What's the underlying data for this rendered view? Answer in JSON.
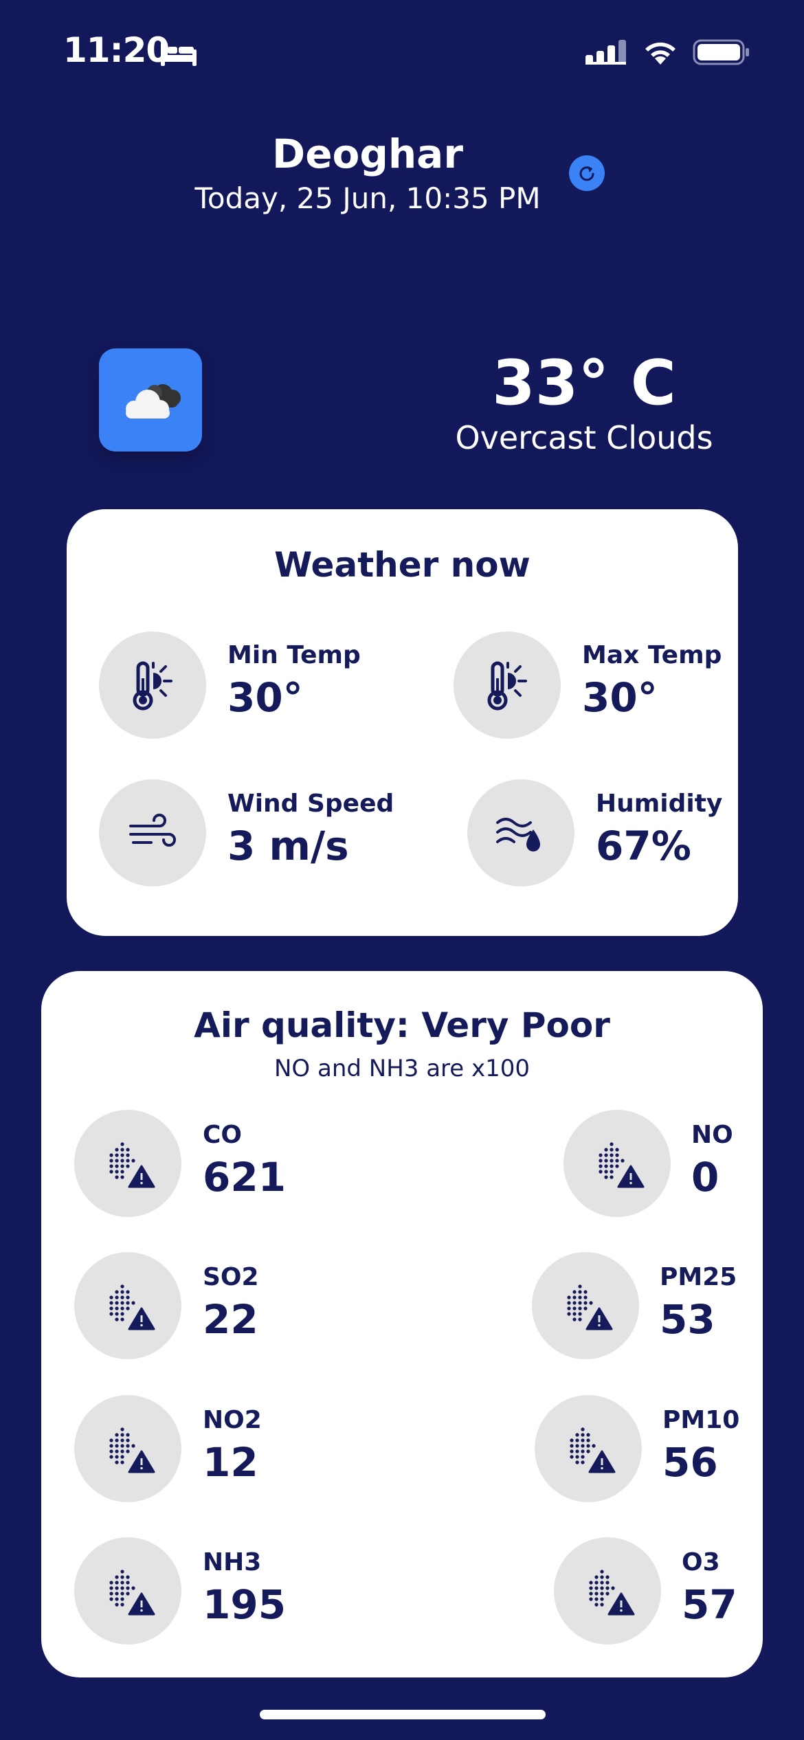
{
  "status_bar": {
    "time": "11:20",
    "icons": [
      "bed-icon",
      "cellular-signal-icon",
      "wifi-icon",
      "battery-icon"
    ]
  },
  "header": {
    "city": "Deoghar",
    "datetime": "Today, 25 Jun, 10:35 PM",
    "refresh_icon": "refresh-icon"
  },
  "current": {
    "icon": "cloud-icon",
    "temperature": "33° C",
    "description": "Overcast Clouds"
  },
  "weather_now": {
    "title": "Weather now",
    "items": [
      {
        "label": "Min Temp",
        "value": "30°",
        "icon": "thermometer-sun-icon"
      },
      {
        "label": "Max Temp",
        "value": "30°",
        "icon": "thermometer-sun-icon"
      },
      {
        "label": "Wind Speed",
        "value": "3 m/s",
        "icon": "wind-icon"
      },
      {
        "label": "Humidity",
        "value": "67%",
        "icon": "humidity-icon"
      }
    ]
  },
  "air_quality": {
    "title": "Air quality: Very Poor",
    "subtitle": "NO and NH3 are x100",
    "items": [
      {
        "label": "CO",
        "value": "621",
        "icon": "particles-warning-icon"
      },
      {
        "label": "NO",
        "value": "0",
        "icon": "particles-warning-icon"
      },
      {
        "label": "SO2",
        "value": "22",
        "icon": "particles-warning-icon"
      },
      {
        "label": "PM25",
        "value": "53",
        "icon": "particles-warning-icon"
      },
      {
        "label": "NO2",
        "value": "12",
        "icon": "particles-warning-icon"
      },
      {
        "label": "PM10",
        "value": "56",
        "icon": "particles-warning-icon"
      },
      {
        "label": "NH3",
        "value": "195",
        "icon": "particles-warning-icon"
      },
      {
        "label": "O3",
        "value": "57",
        "icon": "particles-warning-icon"
      }
    ]
  },
  "colors": {
    "background": "#13185a",
    "accent": "#3b82f6",
    "card": "#ffffff",
    "text_dark": "#151a5a",
    "icon_circle": "#e3e3e3"
  }
}
